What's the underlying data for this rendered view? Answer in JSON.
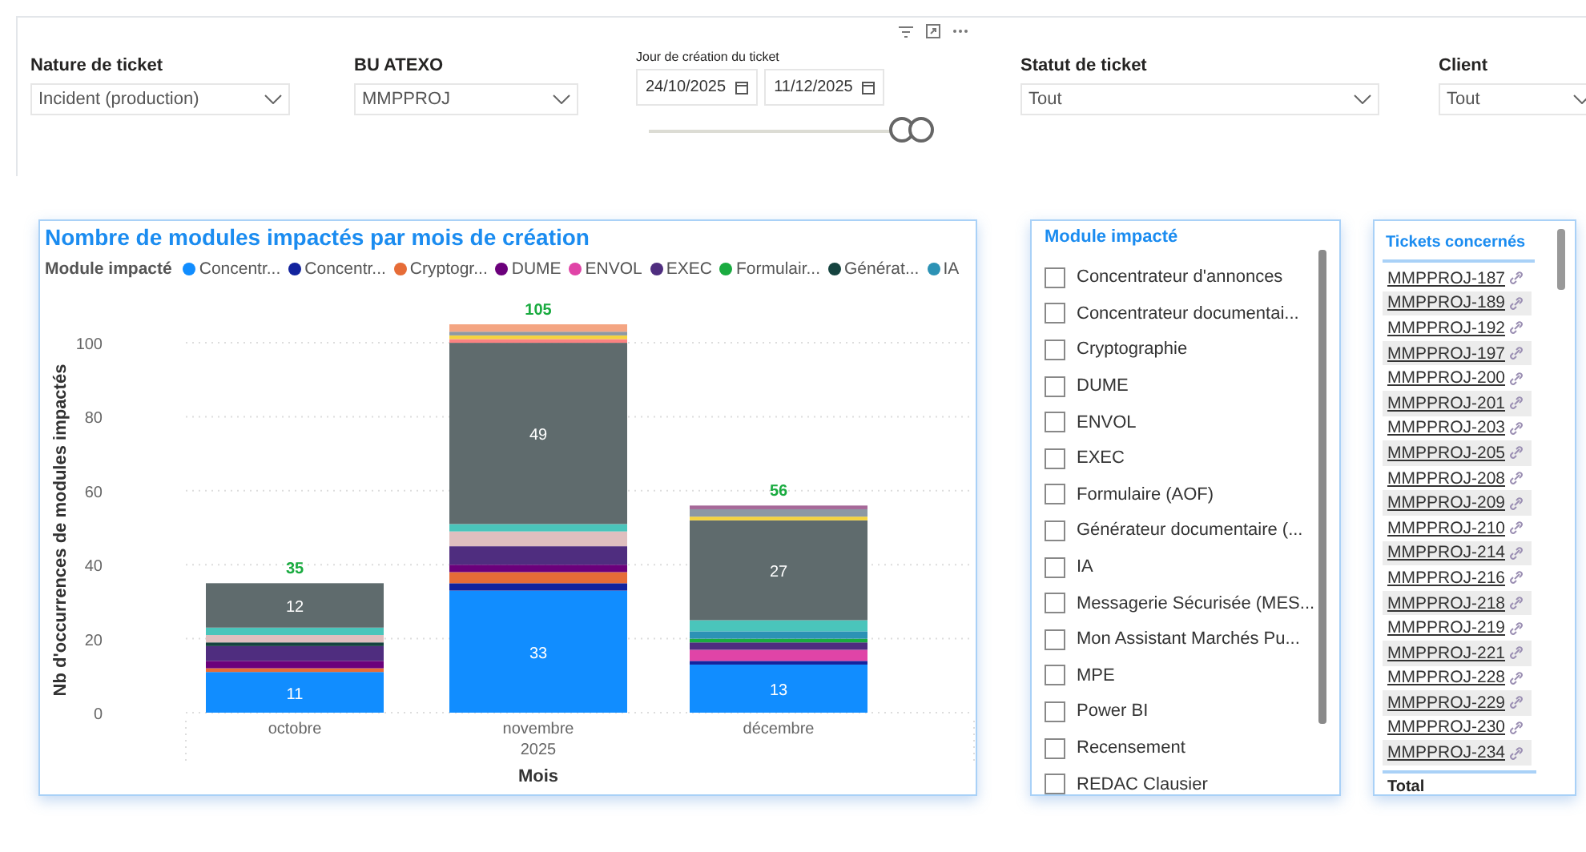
{
  "filters": [
    {
      "kind": "dropdown",
      "label": "Nature de ticket",
      "value": "Incident (production)"
    },
    {
      "kind": "dropdown",
      "label": "BU ATEXO",
      "value": "MMPPROJ"
    },
    {
      "kind": "daterange",
      "label": "Jour de création du ticket",
      "start": "24/10/2025",
      "end": "11/12/2025",
      "thumbs": [
        {
          "level": 0.93
        },
        {
          "level": 1
        }
      ]
    },
    {
      "kind": "dropdown",
      "label": "Statut de ticket",
      "value": "Tout"
    },
    {
      "kind": "dropdown",
      "label": "Client",
      "value": "Tout"
    }
  ],
  "chart": {
    "legend_title": "Module impacté",
    "year_label": "2025",
    "totals": [
      "35",
      "105",
      "56"
    ],
    "chart_data": {
      "type": "bar",
      "stacked": true,
      "title": "Nombre de modules impactés par mois de création",
      "xlabel": "Mois",
      "ylabel": "Nb d'occurrences de modules impactés",
      "categories": [
        "octobre",
        "novembre",
        "décembre"
      ],
      "ylim": [
        0,
        105
      ],
      "yticks": [
        0,
        20,
        40,
        60,
        80,
        100
      ],
      "grid": true,
      "series": [
        {
          "name": "Concentr...",
          "color": "#118dff",
          "values": [
            11,
            33,
            13
          ],
          "value_labels": [
            "11",
            "33",
            "13"
          ]
        },
        {
          "name": "Concentr...",
          "color": "#12239e",
          "values": [
            0,
            2,
            1
          ]
        },
        {
          "name": "Cryptogr...",
          "color": "#e66c37",
          "values": [
            1,
            3,
            0
          ]
        },
        {
          "name": "DUME",
          "color": "#6b007b",
          "values": [
            2,
            2,
            0
          ]
        },
        {
          "name": "ENVOL",
          "color": "#e044a7",
          "values": [
            0,
            0,
            3
          ]
        },
        {
          "name": "EXEC",
          "color": "#4f2d7f",
          "values": [
            4,
            5,
            2
          ]
        },
        {
          "name": "Formulair...",
          "color": "#1aab40",
          "values": [
            0,
            0,
            1
          ]
        },
        {
          "name": "Générat...",
          "color": "#15433f",
          "values": [
            1,
            0,
            0
          ]
        },
        {
          "name": "IA",
          "color": "#2c92b5",
          "values": [
            0,
            0,
            2
          ]
        },
        {
          "color": "#dfbfbf",
          "values": [
            2,
            4,
            0
          ]
        },
        {
          "color": "#4ac5bb",
          "values": [
            2,
            2,
            3
          ]
        },
        {
          "color": "#5f6b6d",
          "values": [
            12,
            49,
            27
          ],
          "value_labels": [
            "12",
            "49",
            "27"
          ]
        },
        {
          "color": "#fb8281",
          "values": [
            0,
            1,
            0
          ]
        },
        {
          "color": "#f5d33f",
          "values": [
            0,
            1,
            1
          ]
        },
        {
          "color": "#8d98a3",
          "values": [
            0,
            1,
            2
          ]
        },
        {
          "color": "#a66999",
          "values": [
            0,
            0,
            1
          ]
        },
        {
          "color": "#f4a582",
          "values": [
            0,
            2,
            0
          ]
        }
      ]
    }
  },
  "module_slicer": {
    "title": "Module impacté",
    "items": [
      {
        "label": "Concentrateur d'annonces",
        "checked": false
      },
      {
        "label": "Concentrateur documentai...",
        "checked": false
      },
      {
        "label": "Cryptographie",
        "checked": false
      },
      {
        "label": "DUME",
        "checked": false
      },
      {
        "label": "ENVOL",
        "checked": false
      },
      {
        "label": "EXEC",
        "checked": false
      },
      {
        "label": "Formulaire (AOF)",
        "checked": false
      },
      {
        "label": "Générateur documentaire (...",
        "checked": false
      },
      {
        "label": "IA",
        "checked": false
      },
      {
        "label": "Messagerie Sécurisée (MES...",
        "checked": false
      },
      {
        "label": "Mon Assistant Marchés Pu...",
        "checked": false
      },
      {
        "label": "MPE",
        "checked": false
      },
      {
        "label": "Power BI",
        "checked": false
      },
      {
        "label": "Recensement",
        "checked": false
      },
      {
        "label": "REDAC Clausier",
        "checked": false
      }
    ]
  },
  "tickets_table": {
    "column": "Tickets concernés",
    "rows": [
      "MMPPROJ-187",
      "MMPPROJ-189",
      "MMPPROJ-192",
      "MMPPROJ-197",
      "MMPPROJ-200",
      "MMPPROJ-201",
      "MMPPROJ-203",
      "MMPPROJ-205",
      "MMPPROJ-208",
      "MMPPROJ-209",
      "MMPPROJ-210",
      "MMPPROJ-214",
      "MMPPROJ-216",
      "MMPPROJ-218",
      "MMPPROJ-219",
      "MMPPROJ-221",
      "MMPPROJ-228",
      "MMPPROJ-229",
      "MMPPROJ-230",
      "MMPPROJ-234"
    ],
    "total_label": "Total"
  }
}
